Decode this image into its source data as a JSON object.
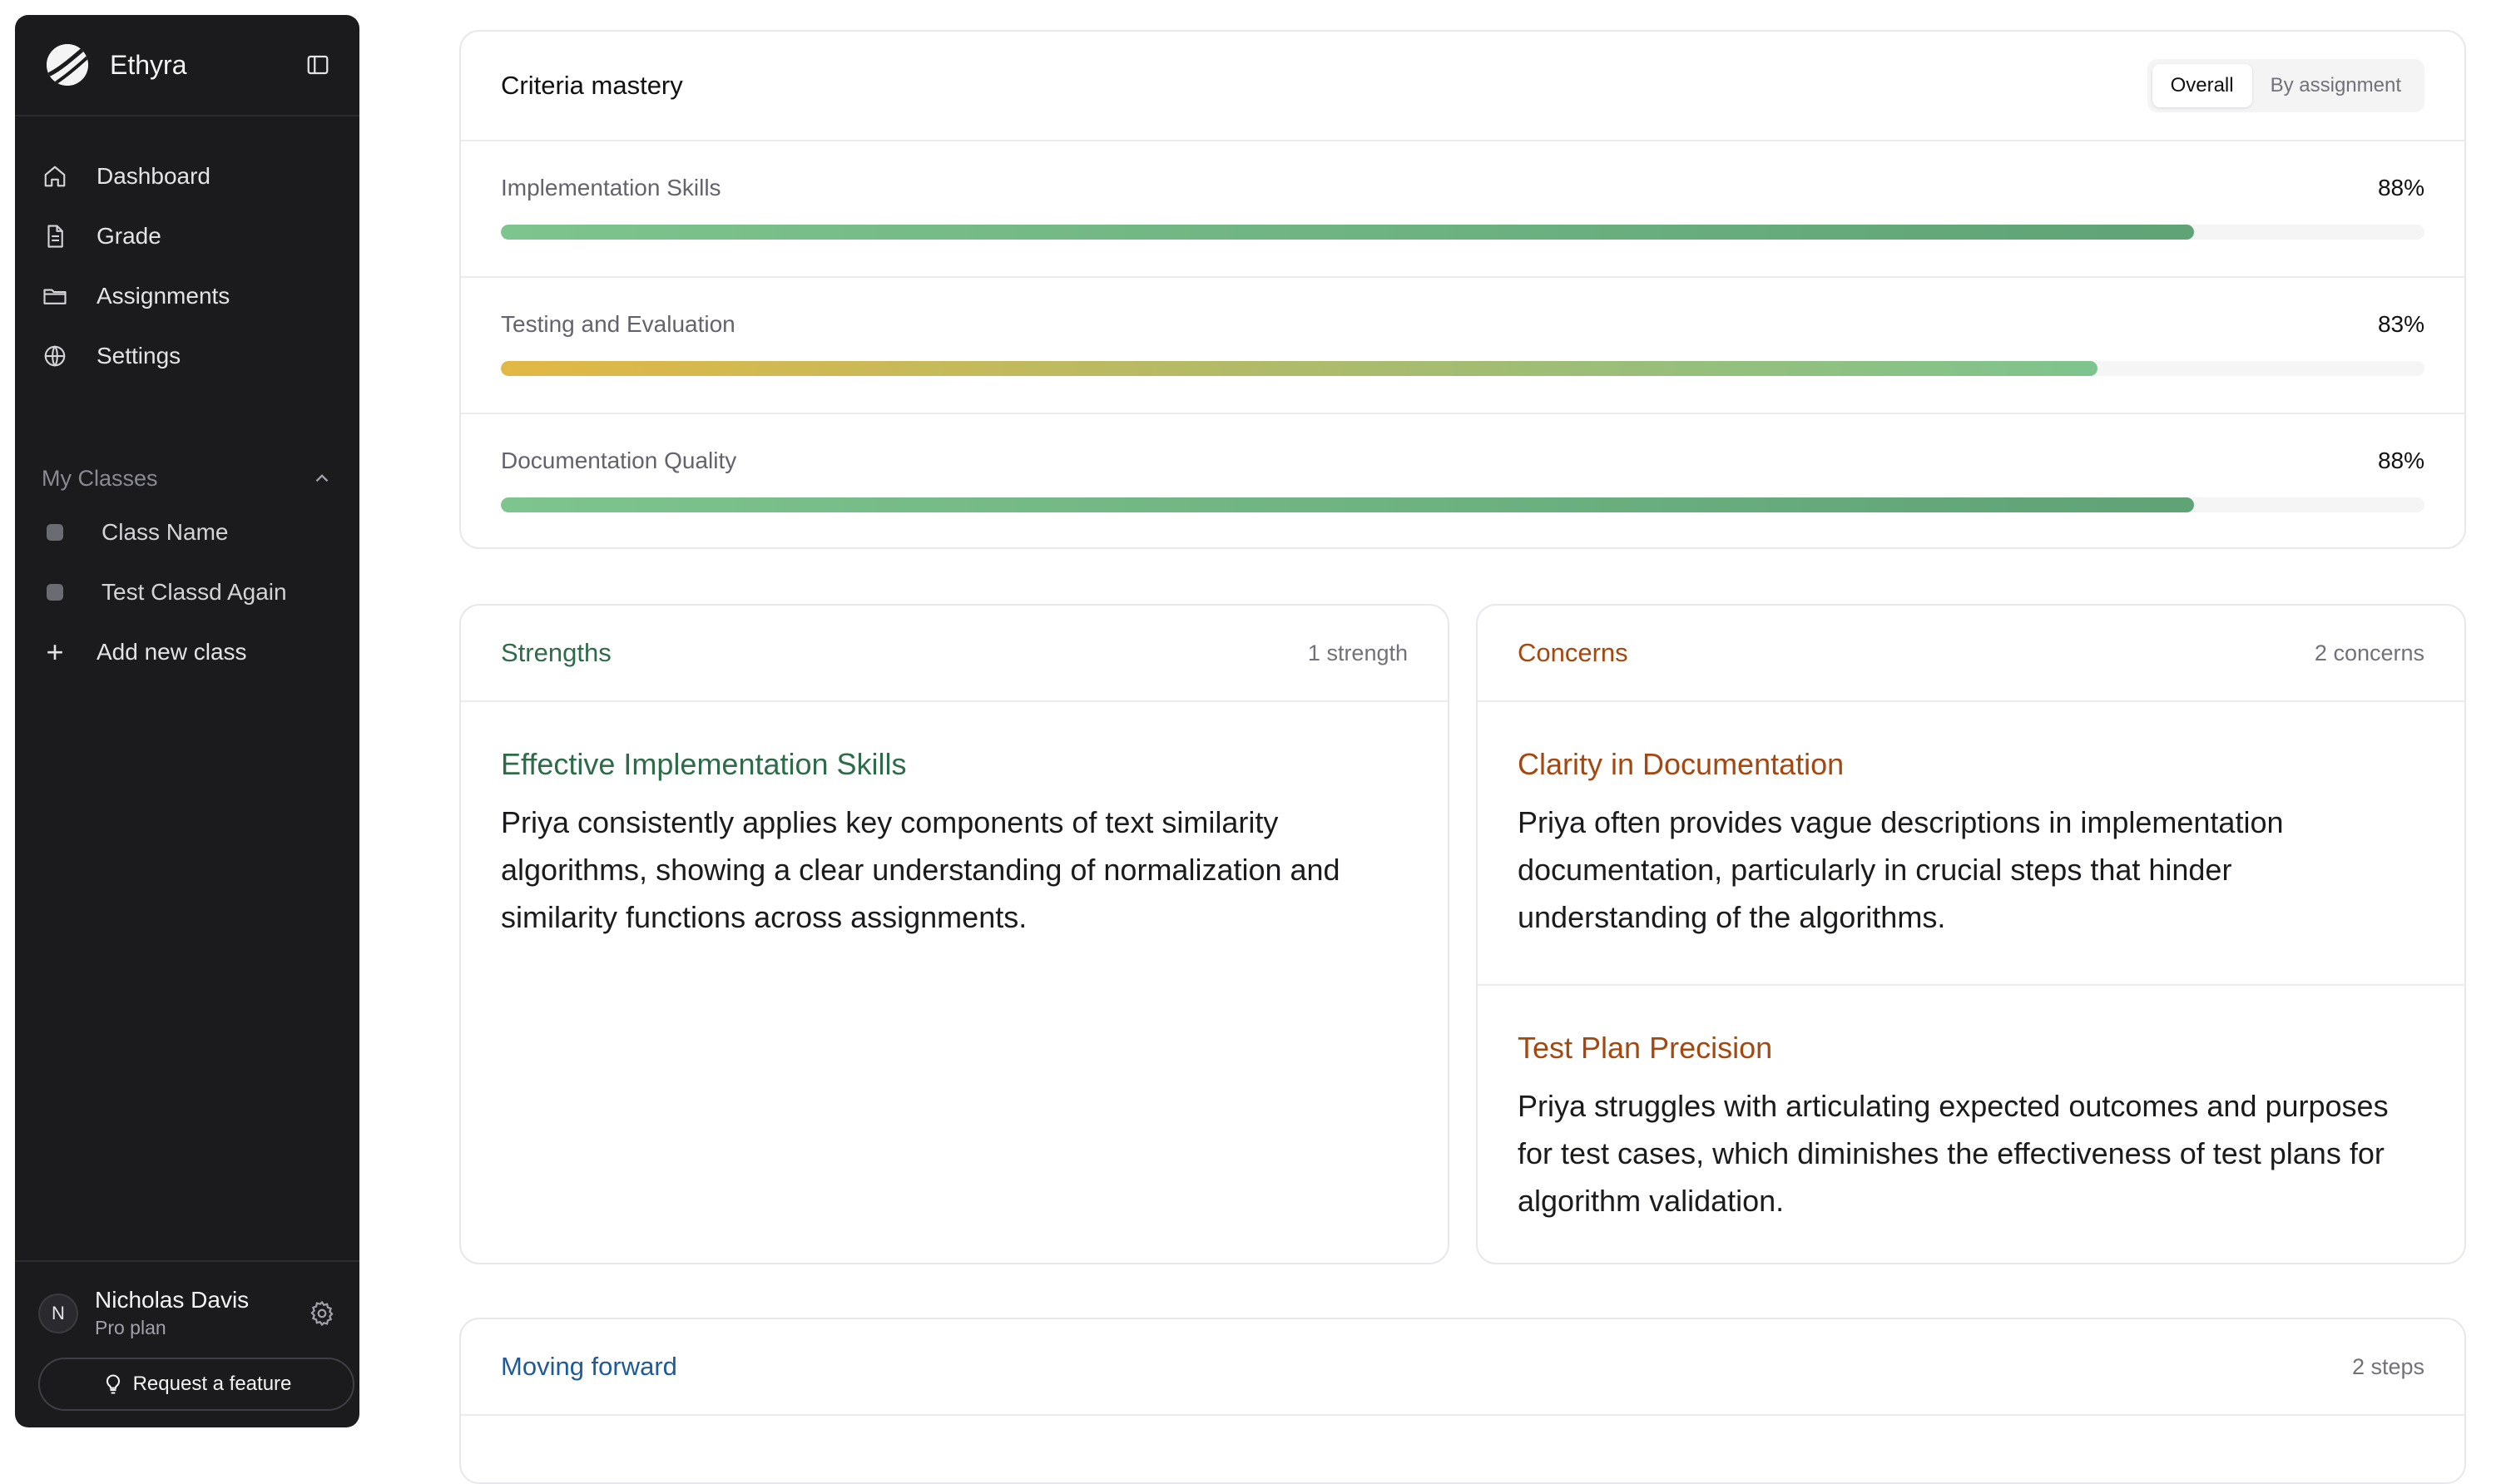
{
  "sidebar": {
    "brand": "Ethyra",
    "nav": [
      {
        "label": "Dashboard",
        "icon": "home-icon"
      },
      {
        "label": "Grade",
        "icon": "document-icon"
      },
      {
        "label": "Assignments",
        "icon": "folder-icon"
      },
      {
        "label": "Settings",
        "icon": "globe-icon"
      }
    ],
    "classes_heading": "My Classes",
    "classes": [
      {
        "label": "Class Name"
      },
      {
        "label": "Test Classd Again"
      }
    ],
    "add_class_label": "Add new class",
    "user": {
      "initial": "N",
      "name": "Nicholas Davis",
      "plan": "Pro plan"
    },
    "request_feature_label": "Request a feature"
  },
  "mastery": {
    "title": "Criteria mastery",
    "toggle": {
      "overall": "Overall",
      "by_assignment": "By assignment",
      "selected": "Overall"
    },
    "criteria": [
      {
        "name": "Implementation Skills",
        "percent_label": "88%",
        "value": 88,
        "color": "#6fb584"
      },
      {
        "name": "Testing and Evaluation",
        "percent_label": "83%",
        "value": 83,
        "color": "#e2b845"
      },
      {
        "name": "Documentation Quality",
        "percent_label": "88%",
        "value": 88,
        "color": "#6fb584"
      }
    ]
  },
  "strengths": {
    "title": "Strengths",
    "count": "1 strength",
    "items": [
      {
        "title": "Effective Implementation Skills",
        "body": "Priya consistently applies key components of text similarity algorithms, showing a clear understanding of normalization and similarity functions across assignments."
      }
    ]
  },
  "concerns": {
    "title": "Concerns",
    "count": "2 concerns",
    "items": [
      {
        "title": "Clarity in Documentation",
        "body": "Priya often provides vague descriptions in implementation documentation, particularly in crucial steps that hinder understanding of the algorithms."
      },
      {
        "title": "Test Plan Precision",
        "body": "Priya struggles with articulating expected outcomes and purposes for test cases, which diminishes the effectiveness of test plans for algorithm validation."
      }
    ]
  },
  "forward": {
    "title": "Moving forward",
    "count": "2 steps"
  },
  "colors": {
    "green_accent": "#2e6b48",
    "orange_accent": "#a5480f",
    "blue_accent": "#1f5a99",
    "sidebar_bg": "#1b1b1d"
  }
}
